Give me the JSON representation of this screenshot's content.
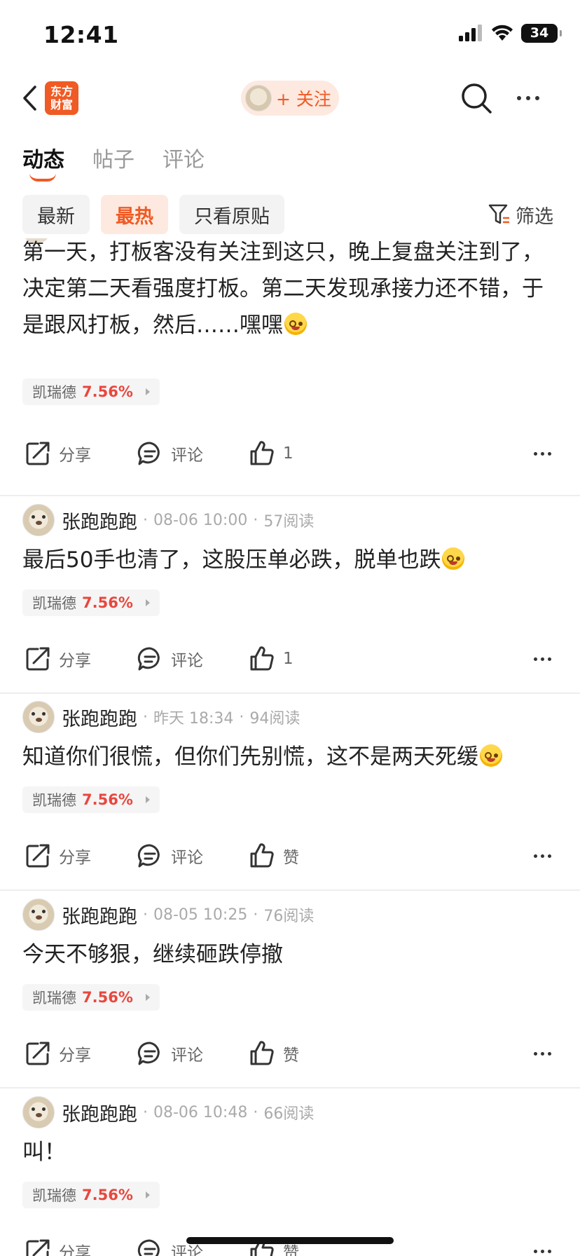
{
  "status_bar": {
    "time": "12:41",
    "battery": "34"
  },
  "nav": {
    "logo_line1": "东方",
    "logo_line2": "财富",
    "follow_label": "+ 关注"
  },
  "tabs": [
    {
      "label": "动态"
    },
    {
      "label": "帖子"
    },
    {
      "label": "评论"
    }
  ],
  "filters": {
    "chips": [
      {
        "label": "最新"
      },
      {
        "label": "最热"
      },
      {
        "label": "只看原贴"
      }
    ],
    "filter_label": "筛选"
  },
  "posts": [
    {
      "content": "第一天，打板客没有关注到这只，晚上复盘关注到了，决定第二天看强度打板。第二天发现承接力还不错，于是跟风打板，然后……嘿嘿",
      "stock": "凯瑞德",
      "pct": "7.56%",
      "share": "分享",
      "comment": "评论",
      "like": "1"
    },
    {
      "author": "张跑跑跑",
      "time": "08-06 10:00",
      "reads": "57阅读",
      "content": "最后50手也清了，这股压单必跌，脱单也跌",
      "stock": "凯瑞德",
      "pct": "7.56%",
      "share": "分享",
      "comment": "评论",
      "like": "1"
    },
    {
      "author": "张跑跑跑",
      "time": "昨天 18:34",
      "reads": "94阅读",
      "content": "知道你们很慌，但你们先别慌，这不是两天死缓",
      "stock": "凯瑞德",
      "pct": "7.56%",
      "share": "分享",
      "comment": "评论",
      "like": "赞"
    },
    {
      "author": "张跑跑跑",
      "time": "08-05 10:25",
      "reads": "76阅读",
      "content": "今天不够狠，继续砸跌停撤",
      "stock": "凯瑞德",
      "pct": "7.56%",
      "share": "分享",
      "comment": "评论",
      "like": "赞"
    },
    {
      "author": "张跑跑跑",
      "time": "08-06 10:48",
      "reads": "66阅读",
      "content": "叫！",
      "stock": "凯瑞德",
      "pct": "7.56%",
      "share": "分享",
      "comment": "评论",
      "like": "赞"
    }
  ],
  "colors": {
    "accent": "#f05a24",
    "stock_up": "#e8473e"
  }
}
